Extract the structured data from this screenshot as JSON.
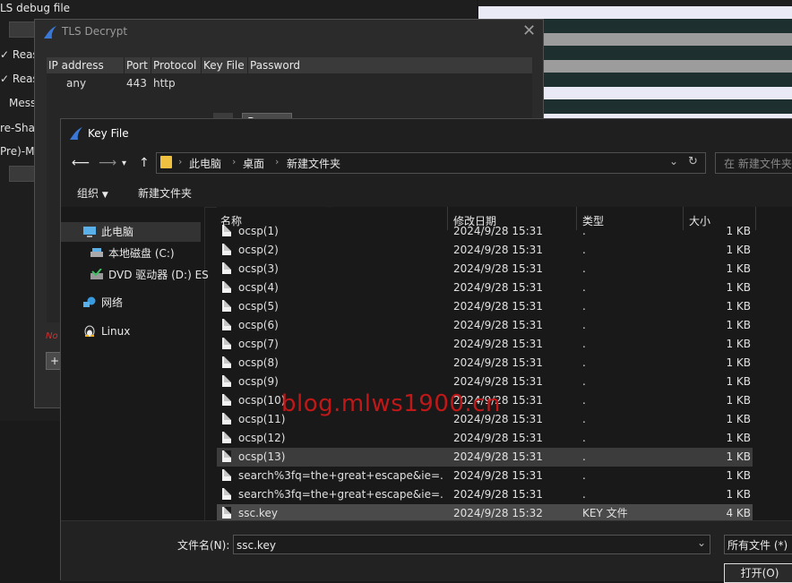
{
  "bg_window": {
    "title": "LS debug file",
    "rows": [
      "Reas",
      "Reas",
      "Mess",
      "re-Shar",
      "Pre)-Ma"
    ]
  },
  "tls_dialog": {
    "title": "TLS Decrypt",
    "columns": [
      "IP address",
      "Port",
      "Protocol",
      "Key File",
      "Password"
    ],
    "row": {
      "ip": "any",
      "port": "443",
      "protocol": "http",
      "browse_label": "Browse"
    },
    "error_text": "No",
    "add_button": "+"
  },
  "key_file_dialog": {
    "title": "Key File",
    "breadcrumbs": [
      "此电脑",
      "桌面",
      "新建文件夹"
    ],
    "search_placeholder": "在 新建文件夹",
    "toolbar": {
      "organize": "组织",
      "new_folder": "新建文件夹"
    },
    "sidebar": [
      {
        "label": "此电脑",
        "icon": "computer-icon"
      },
      {
        "label": "本地磁盘 (C:)",
        "icon": "drive-icon"
      },
      {
        "label": "DVD 驱动器 (D:) ES",
        "icon": "dvd-icon"
      },
      {
        "label": "网络",
        "icon": "network-icon"
      },
      {
        "label": "Linux",
        "icon": "linux-icon"
      }
    ],
    "columns": {
      "name": "名称",
      "date": "修改日期",
      "type": "类型",
      "size": "大小"
    },
    "files": [
      {
        "name": "ocsp(1)",
        "date": "2024/9/28 15:31",
        "type": ".",
        "size": "1 KB"
      },
      {
        "name": "ocsp(2)",
        "date": "2024/9/28 15:31",
        "type": ".",
        "size": "1 KB"
      },
      {
        "name": "ocsp(3)",
        "date": "2024/9/28 15:31",
        "type": ".",
        "size": "1 KB"
      },
      {
        "name": "ocsp(4)",
        "date": "2024/9/28 15:31",
        "type": ".",
        "size": "1 KB"
      },
      {
        "name": "ocsp(5)",
        "date": "2024/9/28 15:31",
        "type": ".",
        "size": "1 KB"
      },
      {
        "name": "ocsp(6)",
        "date": "2024/9/28 15:31",
        "type": ".",
        "size": "1 KB"
      },
      {
        "name": "ocsp(7)",
        "date": "2024/9/28 15:31",
        "type": ".",
        "size": "1 KB"
      },
      {
        "name": "ocsp(8)",
        "date": "2024/9/28 15:31",
        "type": ".",
        "size": "1 KB"
      },
      {
        "name": "ocsp(9)",
        "date": "2024/9/28 15:31",
        "type": ".",
        "size": "1 KB"
      },
      {
        "name": "ocsp(10)",
        "date": "2024/9/28 15:31",
        "type": ".",
        "size": "1 KB"
      },
      {
        "name": "ocsp(11)",
        "date": "2024/9/28 15:31",
        "type": ".",
        "size": "1 KB"
      },
      {
        "name": "ocsp(12)",
        "date": "2024/9/28 15:31",
        "type": ".",
        "size": "1 KB"
      },
      {
        "name": "ocsp(13)",
        "date": "2024/9/28 15:31",
        "type": ".",
        "size": "1 KB"
      },
      {
        "name": "search%3fq=the+great+escape&ie=...",
        "date": "2024/9/28 15:31",
        "type": ".",
        "size": "1 KB"
      },
      {
        "name": "search%3fq=the+great+escape&ie=...",
        "date": "2024/9/28 15:31",
        "type": ".",
        "size": "1 KB"
      },
      {
        "name": "ssc.key",
        "date": "2024/9/28 15:32",
        "type": "KEY 文件",
        "size": "4 KB"
      }
    ],
    "hovered_index": 12,
    "selected_index": 15,
    "filename_label": "文件名(N):",
    "filename_value": "ssc.key",
    "filetype_value": "所有文件 (*)",
    "open_button": "打开(O)"
  },
  "watermark": "blog.mlws1900.cn",
  "colors": {
    "accent": "#3a78d8",
    "watermark": "#c01818"
  }
}
